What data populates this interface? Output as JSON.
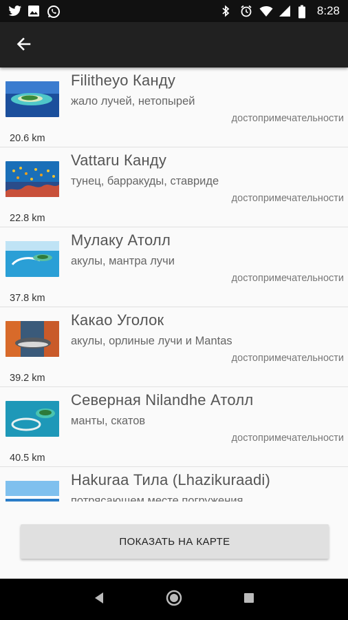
{
  "status_bar": {
    "time": "8:28",
    "icons_left": [
      "twitter-icon",
      "image-icon",
      "whatsapp-icon"
    ],
    "icons_right": [
      "bluetooth-icon",
      "alarm-icon",
      "wifi-icon",
      "signal-icon",
      "battery-icon"
    ]
  },
  "app_bar": {
    "back_icon": "arrow-back-icon"
  },
  "items": [
    {
      "title": "Filitheyo Канду",
      "subtitle": "жало лучей, нетопырей",
      "category": "достопримечательности",
      "distance": "20.6 km"
    },
    {
      "title": "Vattaru Канду",
      "subtitle": "тунец, барракуды, ставриде",
      "category": "достопримечательности",
      "distance": "22.8 km"
    },
    {
      "title": "Мулаку Атолл",
      "subtitle": "акулы, мантра лучи",
      "category": "достопримечательности",
      "distance": "37.8 km"
    },
    {
      "title": "Какао Уголок",
      "subtitle": "акулы, орлиные лучи и Mantas",
      "category": "достопримечательности",
      "distance": "39.2 km"
    },
    {
      "title": "Северная Nilandhe Атолл",
      "subtitle": "манты, скатов",
      "category": "достопримечательности",
      "distance": "40.5 km"
    },
    {
      "title": "Hakuraa Тила (Lhazikuraadi)",
      "subtitle": "потрясающем месте погружения",
      "category": "",
      "distance": ""
    }
  ],
  "map_button": {
    "label": "ПОКАЗАТЬ НА КАРТЕ"
  },
  "nav_bar": {
    "icons": [
      "back-triangle-icon",
      "home-circle-icon",
      "recents-square-icon"
    ]
  },
  "colors": {
    "status_bar": "#111111",
    "app_bar": "#212121",
    "background": "#fafafa",
    "button": "#e0e0e0"
  }
}
